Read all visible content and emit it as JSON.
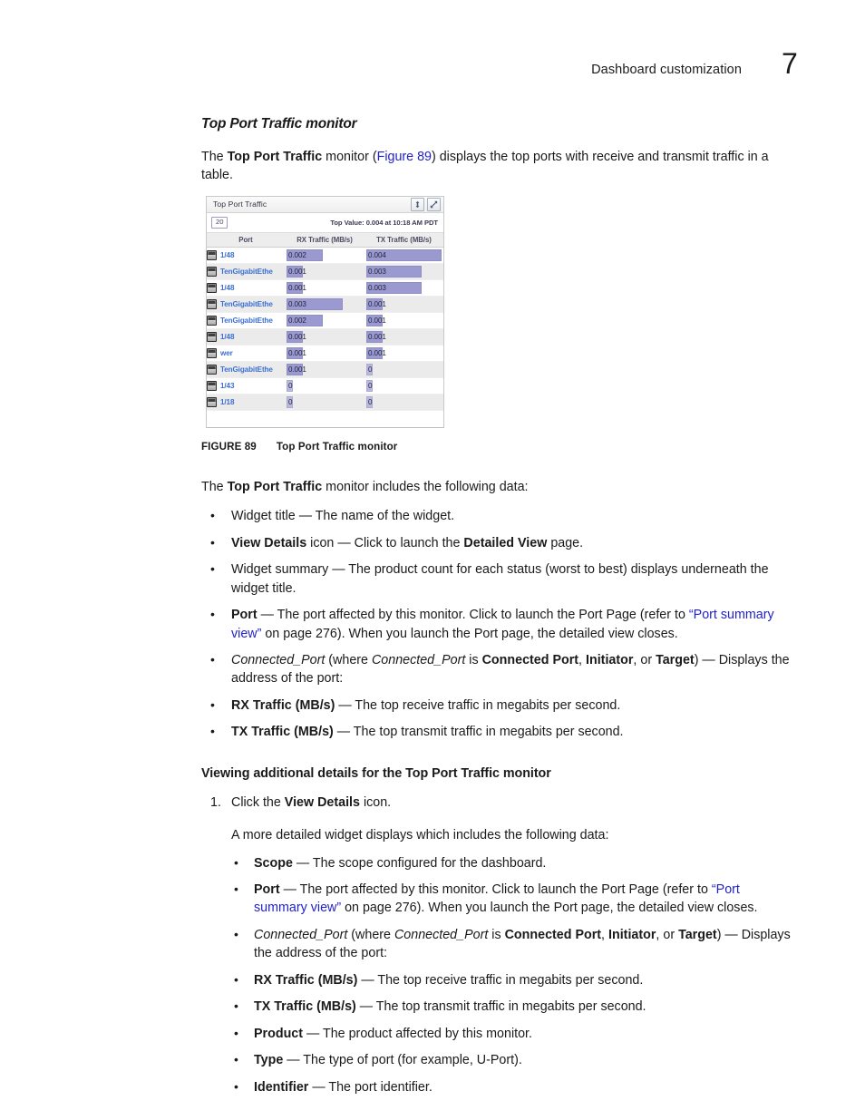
{
  "header": {
    "chapter_title": "Dashboard customization",
    "page_number": "7"
  },
  "section": {
    "heading": "Top Port Traffic monitor",
    "intro_prefix": "The ",
    "intro_bold": "Top Port Traffic",
    "intro_mid": " monitor (",
    "intro_xref": "Figure 89",
    "intro_suffix": ") displays the top ports with receive and transmit traffic in a table."
  },
  "figure": {
    "caption_label": "FIGURE 89",
    "caption_text": "Top Port Traffic monitor",
    "widget": {
      "title": "Top Port Traffic",
      "resize_icon": "vertical-resize-icon",
      "expand_icon": "expand-icon",
      "count_badge": "20",
      "top_value": "Top Value: 0.004 at 10:18 AM PDT",
      "columns": [
        "Port",
        "RX Traffic (MB/s)",
        "TX Traffic (MB/s)"
      ],
      "rows": [
        {
          "port": "1/48",
          "rx": "0.002",
          "tx": "0.004",
          "rx_pct": 50,
          "tx_pct": 100
        },
        {
          "port": "TenGigabitEthe",
          "rx": "0.001",
          "tx": "0.003",
          "rx_pct": 25,
          "tx_pct": 75
        },
        {
          "port": "1/48",
          "rx": "0.001",
          "tx": "0.003",
          "rx_pct": 25,
          "tx_pct": 75
        },
        {
          "port": "TenGigabitEthe",
          "rx": "0.003",
          "tx": "0.001",
          "rx_pct": 75,
          "tx_pct": 25
        },
        {
          "port": "TenGigabitEthe",
          "rx": "0.002",
          "tx": "0.001",
          "rx_pct": 50,
          "tx_pct": 25
        },
        {
          "port": "1/48",
          "rx": "0.001",
          "tx": "0.001",
          "rx_pct": 25,
          "tx_pct": 25
        },
        {
          "port": "wer",
          "rx": "0.001",
          "tx": "0.001",
          "rx_pct": 25,
          "tx_pct": 25
        },
        {
          "port": "TenGigabitEthe",
          "rx": "0.001",
          "tx": "0",
          "rx_pct": 25,
          "tx_pct": 3
        },
        {
          "port": "1/43",
          "rx": "0",
          "tx": "0",
          "rx_pct": 3,
          "tx_pct": 3
        },
        {
          "port": "1/18",
          "rx": "0",
          "tx": "0",
          "rx_pct": 3,
          "tx_pct": 3
        }
      ]
    }
  },
  "data_intro": {
    "prefix": "The ",
    "bold": "Top Port Traffic",
    "suffix": " monitor includes the following data:"
  },
  "data_bullets": [
    {
      "segments": [
        {
          "t": "Widget title",
          "s": "normal"
        },
        {
          "t": " — The name of the widget.",
          "s": "normal"
        }
      ]
    },
    {
      "segments": [
        {
          "t": "View Details",
          "s": "bold"
        },
        {
          "t": " icon — Click to launch the ",
          "s": "normal"
        },
        {
          "t": "Detailed View",
          "s": "bold"
        },
        {
          "t": " page.",
          "s": "normal"
        }
      ]
    },
    {
      "segments": [
        {
          "t": "Widget summary — The product count for each status (worst to best) displays underneath the widget title.",
          "s": "normal"
        }
      ]
    },
    {
      "segments": [
        {
          "t": "Port",
          "s": "bold"
        },
        {
          "t": " — The port affected by this monitor. Click to launch the Port Page (refer to ",
          "s": "normal"
        },
        {
          "t": "“Port summary view”",
          "s": "link"
        },
        {
          "t": " on page 276). When you launch the Port page, the detailed view closes.",
          "s": "normal"
        }
      ]
    },
    {
      "segments": [
        {
          "t": "Connected_Port",
          "s": "italic"
        },
        {
          "t": " (where ",
          "s": "normal"
        },
        {
          "t": "Connected_Port",
          "s": "italic"
        },
        {
          "t": " is ",
          "s": "normal"
        },
        {
          "t": "Connected Port",
          "s": "bold"
        },
        {
          "t": ", ",
          "s": "normal"
        },
        {
          "t": "Initiator",
          "s": "bold"
        },
        {
          "t": ", or ",
          "s": "normal"
        },
        {
          "t": "Target",
          "s": "bold"
        },
        {
          "t": ") — Displays the address of the port:",
          "s": "normal"
        }
      ]
    },
    {
      "segments": [
        {
          "t": "RX Traffic (MB/s)",
          "s": "bold"
        },
        {
          "t": " — The top receive traffic in megabits per second.",
          "s": "normal"
        }
      ]
    },
    {
      "segments": [
        {
          "t": "TX Traffic (MB/s)",
          "s": "bold"
        },
        {
          "t": " — The top transmit traffic in megabits per second.",
          "s": "normal"
        }
      ]
    }
  ],
  "procedure": {
    "heading": "Viewing additional details for the Top Port Traffic monitor",
    "step_number": "1.",
    "step_segments": [
      {
        "t": "Click the ",
        "s": "normal"
      },
      {
        "t": "View Details",
        "s": "bold"
      },
      {
        "t": " icon.",
        "s": "normal"
      }
    ],
    "step_body": "A more detailed widget displays which includes the following data:",
    "sub_bullets": [
      {
        "segments": [
          {
            "t": "Scope",
            "s": "bold"
          },
          {
            "t": " — The scope configured for the dashboard.",
            "s": "normal"
          }
        ]
      },
      {
        "segments": [
          {
            "t": "Port",
            "s": "bold"
          },
          {
            "t": " — The port affected by this monitor. Click to launch the Port Page (refer to ",
            "s": "normal"
          },
          {
            "t": "“Port summary view”",
            "s": "link"
          },
          {
            "t": " on page 276). When you launch the Port page, the detailed view closes.",
            "s": "normal"
          }
        ]
      },
      {
        "segments": [
          {
            "t": "Connected_Port",
            "s": "italic"
          },
          {
            "t": " (where ",
            "s": "normal"
          },
          {
            "t": "Connected_Port",
            "s": "italic"
          },
          {
            "t": " is ",
            "s": "normal"
          },
          {
            "t": "Connected Port",
            "s": "bold"
          },
          {
            "t": ", ",
            "s": "normal"
          },
          {
            "t": "Initiator",
            "s": "bold"
          },
          {
            "t": ", or ",
            "s": "normal"
          },
          {
            "t": "Target",
            "s": "bold"
          },
          {
            "t": ") — Displays the address of the port:",
            "s": "normal"
          }
        ]
      },
      {
        "segments": [
          {
            "t": "RX Traffic (MB/s)",
            "s": "bold"
          },
          {
            "t": " — The top receive traffic in megabits per second.",
            "s": "normal"
          }
        ]
      },
      {
        "segments": [
          {
            "t": "TX Traffic (MB/s)",
            "s": "bold"
          },
          {
            "t": " — The top transmit traffic in megabits per second.",
            "s": "normal"
          }
        ]
      },
      {
        "segments": [
          {
            "t": "Product",
            "s": "bold"
          },
          {
            "t": " — The product affected by this monitor.",
            "s": "normal"
          }
        ]
      },
      {
        "segments": [
          {
            "t": "Type",
            "s": "bold"
          },
          {
            "t": " — The type of port (for example, U-Port).",
            "s": "normal"
          }
        ]
      },
      {
        "segments": [
          {
            "t": "Identifier",
            "s": "bold"
          },
          {
            "t": " — The port identifier.",
            "s": "normal"
          }
        ]
      }
    ]
  },
  "colors": {
    "link": "#2222cc",
    "bar_fill": "#9a9ad0",
    "port_link": "#3c6fd0",
    "header_bg": "#ededed"
  }
}
